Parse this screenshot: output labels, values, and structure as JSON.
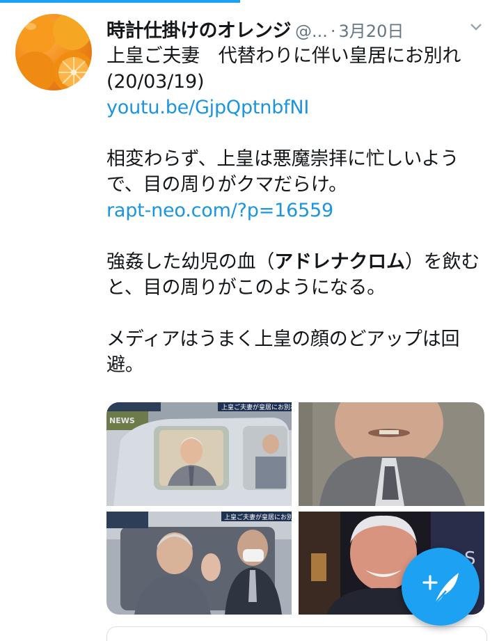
{
  "tweet": {
    "display_name": "時計仕掛けのオレンジ",
    "handle": "@...",
    "separator": "·",
    "date": "3月20日",
    "line1": "上皇ご夫妻　代替わりに伴い皇居にお別れ(20/03/19)",
    "link1": "youtu.be/GjpQptnbfNI",
    "line2": "相変わらず、上皇は悪魔崇拝に忙しいようで、目の周りがクマだらけ。",
    "link2": "rapt-neo.com/?p=16559",
    "line3_pre": "強姦した幼児の血（",
    "line3_bold": "アドレナクロム",
    "line3_post": "）を飲むと、目の周りがこのようになる。",
    "line4": "メディアはうまく上皇の顔のどアップは回避。"
  },
  "media": {
    "tile1_tag": "上皇ご夫妻が皇居にお別れ",
    "tile1_corner": "NEWS",
    "tile3_tag": "上皇ご夫妻が皇居にお別れ",
    "tile4_sign": "S"
  },
  "icons": {
    "caret": "chevron-down-icon",
    "compose": "compose-tweet-icon"
  },
  "colors": {
    "accent": "#1da1f2",
    "link": "#1b95e0",
    "muted": "#657786"
  }
}
